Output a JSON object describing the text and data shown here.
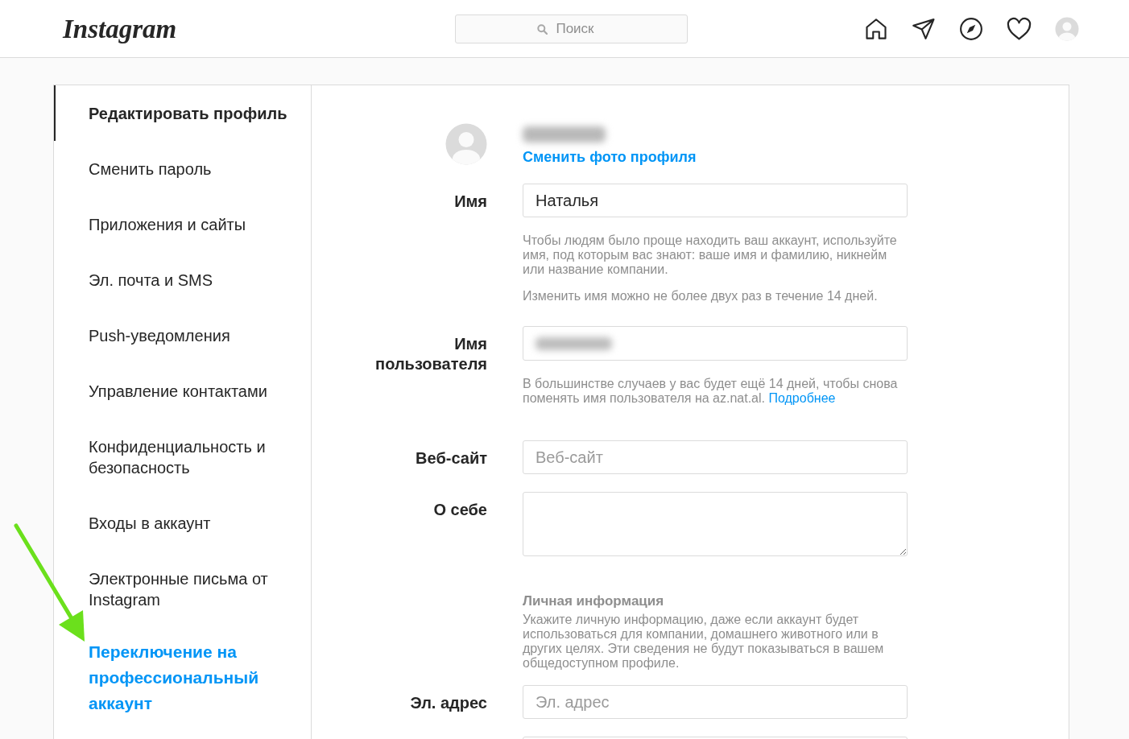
{
  "header": {
    "logo": "Instagram",
    "search": {
      "placeholder": "Поиск"
    }
  },
  "sidebar": {
    "items": [
      {
        "label": "Редактировать профиль",
        "kind": "page",
        "selected": true
      },
      {
        "label": "Сменить пароль",
        "kind": "page",
        "selected": false
      },
      {
        "label": "Приложения и сайты",
        "kind": "page",
        "selected": false
      },
      {
        "label": "Эл. почта и SMS",
        "kind": "page",
        "selected": false
      },
      {
        "label": "Push-уведомления",
        "kind": "page",
        "selected": false
      },
      {
        "label": "Управление контактами",
        "kind": "page",
        "selected": false
      },
      {
        "label": "Конфиденциальность и безопасность",
        "kind": "page",
        "selected": false
      },
      {
        "label": "Входы в аккаунт",
        "kind": "page",
        "selected": false
      },
      {
        "label": "Электронные письма от Instagram",
        "kind": "page",
        "selected": false
      },
      {
        "label": "Переключение на профессиональный аккаунт",
        "kind": "link",
        "selected": false
      }
    ]
  },
  "profile": {
    "username_blurred": true,
    "change_photo": "Сменить фото профиля"
  },
  "form": {
    "fields": [
      {
        "kind": "input",
        "label": "Имя",
        "value": "Наталья",
        "help": [
          "Чтобы людям было проще находить ваш аккаунт, используйте имя, под которым вас знают: ваше имя и фамилию, никнейм или название компании.",
          "Изменить имя можно не более двух раз в течение 14 дней."
        ]
      },
      {
        "kind": "input",
        "label": "Имя пользователя",
        "value_blurred": true,
        "help": [
          "В большинстве случаев у вас будет ещё 14 дней, чтобы снова поменять имя пользователя на az.nat.al."
        ],
        "help_link": "Подробнее"
      },
      {
        "kind": "input",
        "label": "Веб-сайт",
        "placeholder": "Веб-сайт"
      },
      {
        "kind": "textarea",
        "label": "О себе"
      },
      {
        "kind": "section",
        "title": "Личная информация",
        "text": "Укажите личную информацию, даже если аккаунт будет использоваться для компании, домашнего животного или в других целях. Эти сведения не будут показываться в вашем общедоступном профиле."
      },
      {
        "kind": "input",
        "label": "Эл. адрес",
        "placeholder": "Эл. адрес"
      },
      {
        "kind": "input"
      }
    ]
  }
}
